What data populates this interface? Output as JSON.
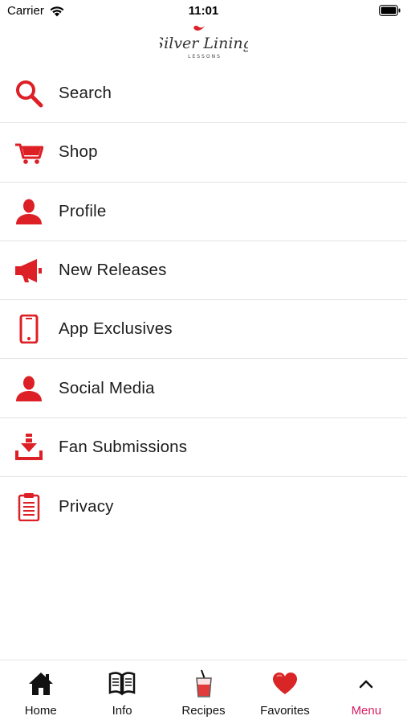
{
  "status_bar": {
    "carrier": "Carrier",
    "time": "11:01"
  },
  "logo": {
    "name": "Silver Lining",
    "tagline": "LESSONS"
  },
  "menu": {
    "items": [
      {
        "label": "Search",
        "icon": "search-icon"
      },
      {
        "label": "Shop",
        "icon": "cart-icon"
      },
      {
        "label": "Profile",
        "icon": "person-icon"
      },
      {
        "label": "New Releases",
        "icon": "megaphone-icon"
      },
      {
        "label": "App Exclusives",
        "icon": "phone-icon"
      },
      {
        "label": "Social Media",
        "icon": "person-icon"
      },
      {
        "label": "Fan Submissions",
        "icon": "download-icon"
      },
      {
        "label": "Privacy",
        "icon": "clipboard-icon"
      }
    ]
  },
  "tab_bar": {
    "tabs": [
      {
        "label": "Home",
        "icon": "home-icon"
      },
      {
        "label": "Info",
        "icon": "book-icon"
      },
      {
        "label": "Recipes",
        "icon": "drink-icon"
      },
      {
        "label": "Favorites",
        "icon": "heart-icon"
      },
      {
        "label": "Menu",
        "icon": "chevron-up-icon"
      }
    ],
    "active": "Menu"
  },
  "colors": {
    "accent": "#dd1f26",
    "active_tab": "#d81b60",
    "divider": "#e3e3e3"
  }
}
